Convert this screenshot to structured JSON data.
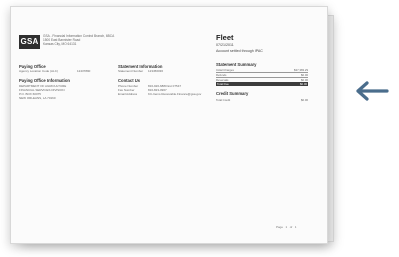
{
  "header": {
    "org_lines": [
      "GSA - Financial Information Control Branch, 6BCA",
      "1500 East Bannister Road",
      "Kansas City, MO 64131"
    ],
    "logo_text": "GSA"
  },
  "title_block": {
    "title": "Fleet",
    "date": "07/21/2011",
    "note": "Account settled through IPAC"
  },
  "paying_office": {
    "heading": "Paying Office",
    "agency_label": "Agency Location Code (ALC)",
    "agency_value": "12437890"
  },
  "paying_office_info": {
    "heading": "Paying Office Information",
    "lines": [
      "DEPARTMENT OF AGRICULTURE",
      "FINANCIAL SERVICES DIVISION",
      "P.O. BOX 60075",
      "NEW ORLEANS, LA 70160"
    ]
  },
  "statement_info": {
    "heading": "Statement Information",
    "statement_label": "Statement Number",
    "statement_value": "123456036"
  },
  "contact": {
    "heading": "Contact Us",
    "rows": [
      {
        "label": "Phone Number",
        "value": "816-926-6880 Ext 07547"
      },
      {
        "label": "Fax Number",
        "value": "816-823-0967"
      },
      {
        "label": "Email Address",
        "value": "KC-Items.Receivable.Finance@gsa.gov"
      }
    ]
  },
  "statement_summary": {
    "heading": "Statement Summary",
    "rows": [
      {
        "label": "Initial Charges",
        "value": "$37,383.29"
      },
      {
        "label": "Refunds",
        "value": "$0.00"
      },
      {
        "label": "Reversals",
        "value": "$0.00"
      },
      {
        "label": "Total Due",
        "value": "$0.00"
      }
    ]
  },
  "credit_summary": {
    "heading": "Credit Summary",
    "rows": [
      {
        "label": "Total Credit",
        "value": "$0.00"
      }
    ]
  },
  "pager": {
    "page_label": "Page",
    "current": "1",
    "of_label": "of",
    "total": "1"
  },
  "colors": {
    "arrow": "#4a6d8c",
    "logo_bg": "#2f2f2f"
  }
}
